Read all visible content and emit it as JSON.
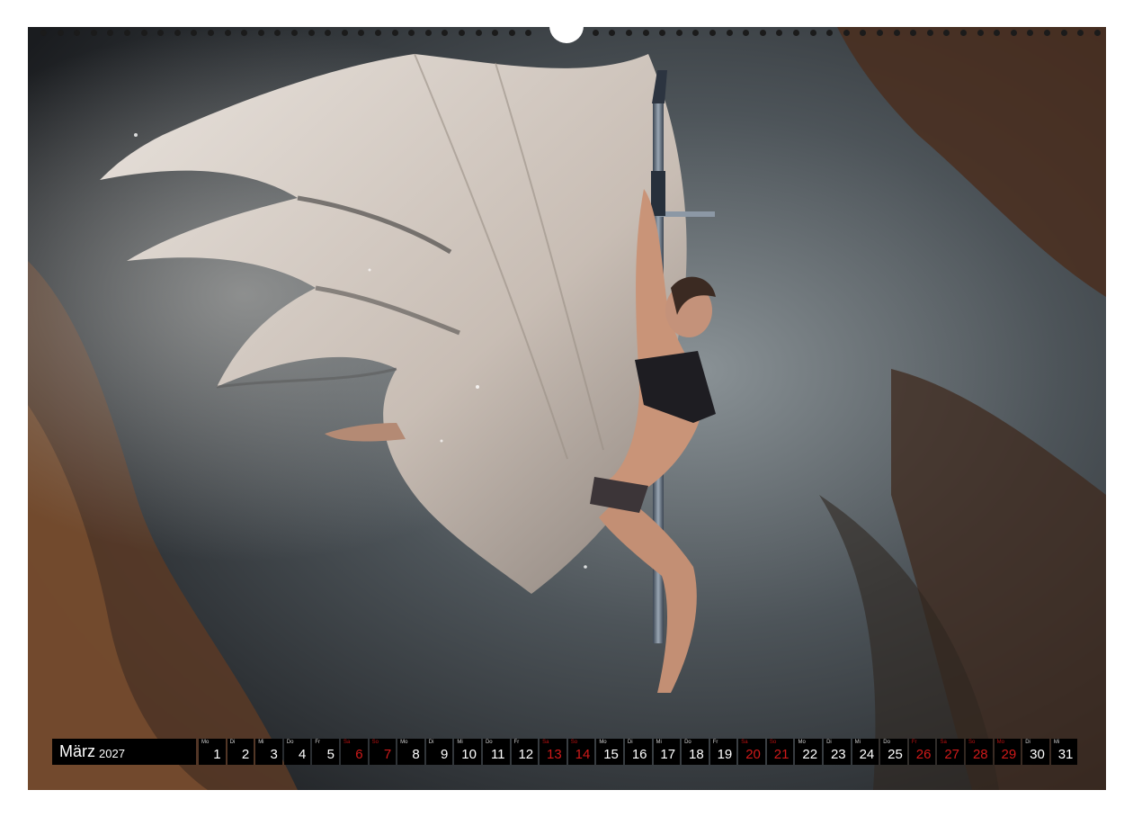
{
  "calendar": {
    "month": "März",
    "year": "2027",
    "days": [
      {
        "wd": "Mo",
        "d": "1",
        "weekend": false
      },
      {
        "wd": "Di",
        "d": "2",
        "weekend": false
      },
      {
        "wd": "Mi",
        "d": "3",
        "weekend": false
      },
      {
        "wd": "Do",
        "d": "4",
        "weekend": false
      },
      {
        "wd": "Fr",
        "d": "5",
        "weekend": false
      },
      {
        "wd": "Sa",
        "d": "6",
        "weekend": true
      },
      {
        "wd": "So",
        "d": "7",
        "weekend": true
      },
      {
        "wd": "Mo",
        "d": "8",
        "weekend": false
      },
      {
        "wd": "Di",
        "d": "9",
        "weekend": false
      },
      {
        "wd": "Mi",
        "d": "10",
        "weekend": false
      },
      {
        "wd": "Do",
        "d": "11",
        "weekend": false
      },
      {
        "wd": "Fr",
        "d": "12",
        "weekend": false
      },
      {
        "wd": "Sa",
        "d": "13",
        "weekend": true
      },
      {
        "wd": "So",
        "d": "14",
        "weekend": true
      },
      {
        "wd": "Mo",
        "d": "15",
        "weekend": false
      },
      {
        "wd": "Di",
        "d": "16",
        "weekend": false
      },
      {
        "wd": "Mi",
        "d": "17",
        "weekend": false
      },
      {
        "wd": "Do",
        "d": "18",
        "weekend": false
      },
      {
        "wd": "Fr",
        "d": "19",
        "weekend": false
      },
      {
        "wd": "Sa",
        "d": "20",
        "weekend": true
      },
      {
        "wd": "So",
        "d": "21",
        "weekend": true
      },
      {
        "wd": "Mo",
        "d": "22",
        "weekend": false
      },
      {
        "wd": "Di",
        "d": "23",
        "weekend": false
      },
      {
        "wd": "Mi",
        "d": "24",
        "weekend": false
      },
      {
        "wd": "Do",
        "d": "25",
        "weekend": false
      },
      {
        "wd": "Fr",
        "d": "26",
        "weekend": true
      },
      {
        "wd": "Sa",
        "d": "27",
        "weekend": true
      },
      {
        "wd": "So",
        "d": "28",
        "weekend": true
      },
      {
        "wd": "Mo",
        "d": "29",
        "weekend": true
      },
      {
        "wd": "Di",
        "d": "30",
        "weekend": false
      },
      {
        "wd": "Mi",
        "d": "31",
        "weekend": false
      }
    ]
  },
  "colors": {
    "strip_bg": "#000000",
    "weekend_red": "#d01a1a",
    "text": "#ffffff"
  }
}
